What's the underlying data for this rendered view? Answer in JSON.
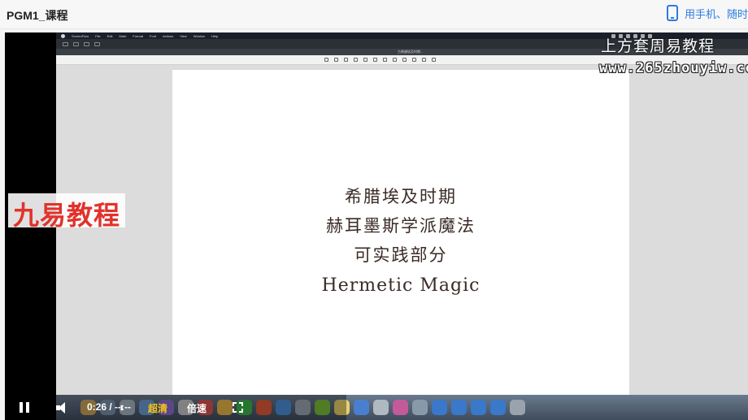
{
  "window": {
    "title": "PGM1_课程"
  },
  "header": {
    "phone_icon": "phone-icon",
    "phone_link": "用手机、随时"
  },
  "mac": {
    "menubar": [
      "ScreenFlow",
      "File",
      "Edit",
      "Mark",
      "Format",
      "Font",
      "Actions",
      "View",
      "Window",
      "Help"
    ],
    "doc_name": "古希腊埃及时期..."
  },
  "document": {
    "lines": [
      "希腊埃及时期",
      "赫耳墨斯学派魔法",
      "可实践部分"
    ],
    "english": "Hermetic Magic"
  },
  "watermarks": {
    "brand": "九易教程",
    "site_cn": "上方套周易教程",
    "site_url": "www.265zhouyiw.com"
  },
  "player": {
    "time": "0:26 / --:--",
    "quality": "超清",
    "speed": "倍速"
  },
  "colors": {
    "accent": "#2a7de1",
    "quality": "#f5c518",
    "brand_red": "#e1322b",
    "doc_text": "#3a2a25"
  }
}
